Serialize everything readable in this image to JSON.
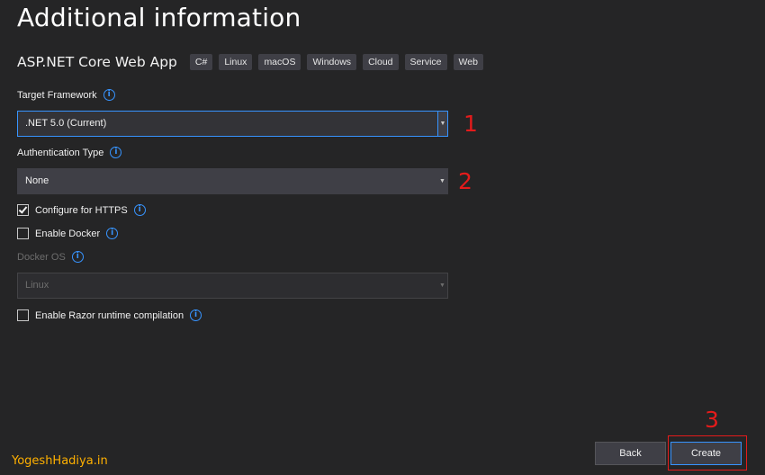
{
  "header": {
    "title": "Additional information",
    "template_name": "ASP.NET Core Web App",
    "tags": [
      "C#",
      "Linux",
      "macOS",
      "Windows",
      "Cloud",
      "Service",
      "Web"
    ]
  },
  "form": {
    "target_framework": {
      "label": "Target Framework",
      "value": ".NET 5.0 (Current)"
    },
    "authentication_type": {
      "label": "Authentication Type",
      "value": "None"
    },
    "configure_https": {
      "label": "Configure for HTTPS",
      "checked": true
    },
    "enable_docker": {
      "label": "Enable Docker",
      "checked": false
    },
    "docker_os": {
      "label": "Docker OS",
      "value": "Linux",
      "disabled": true
    },
    "enable_razor": {
      "label": "Enable Razor runtime compilation",
      "checked": false
    }
  },
  "annotations": {
    "one": "1",
    "two": "2",
    "three": "3"
  },
  "buttons": {
    "back": "Back",
    "create": "Create"
  },
  "watermark": "YogeshHadiya.in",
  "icons": {
    "info": "info-icon",
    "dropdown": "chevron-down-icon",
    "check": "checkmark-icon"
  },
  "colors": {
    "background": "#252526",
    "accent": "#3794ff",
    "annotation": "#e41b1b",
    "watermark": "#ffb000"
  }
}
